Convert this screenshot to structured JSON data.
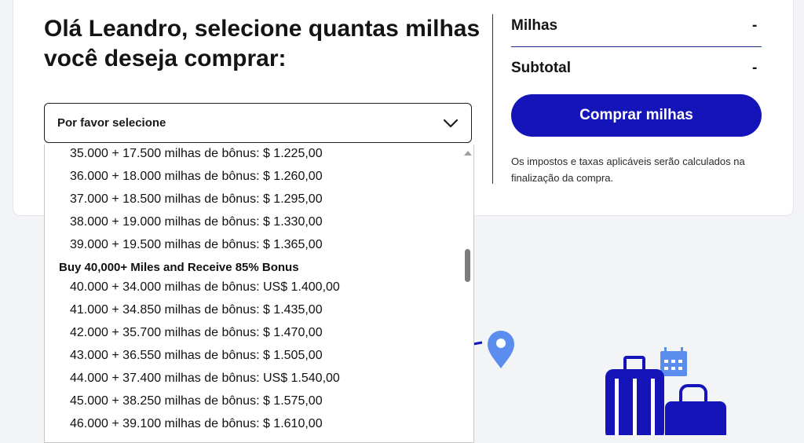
{
  "heading": "Olá Leandro, selecione quantas milhas você deseja comprar:",
  "select": {
    "value": "Por favor selecione"
  },
  "dropdown": {
    "rows": [
      {
        "kind": "option",
        "text": "35.000 + 17.500 milhas de bônus: $ 1.225,00"
      },
      {
        "kind": "option",
        "text": "36.000 + 18.000 milhas de bônus: $ 1.260,00"
      },
      {
        "kind": "option",
        "text": "37.000 + 18.500 milhas de bônus: $ 1.295,00"
      },
      {
        "kind": "option",
        "text": "38.000 + 19.000 milhas de bônus: $ 1.330,00"
      },
      {
        "kind": "option",
        "text": "39.000 + 19.500 milhas de bônus: $ 1.365,00"
      },
      {
        "kind": "group",
        "text": "Buy 40,000+ Miles and Receive 85% Bonus"
      },
      {
        "kind": "option",
        "text": "40.000 + 34.000 milhas de bônus: US$ 1.400,00"
      },
      {
        "kind": "option",
        "text": "41.000 + 34.850 milhas de bônus: $ 1.435,00"
      },
      {
        "kind": "option",
        "text": "42.000 + 35.700 milhas de bônus: $ 1.470,00"
      },
      {
        "kind": "option",
        "text": "43.000 + 36.550 milhas de bônus: $ 1.505,00"
      },
      {
        "kind": "option",
        "text": "44.000 + 37.400 milhas de bônus: US$ 1.540,00"
      },
      {
        "kind": "option",
        "text": "45.000 + 38.250 milhas de bônus: $ 1.575,00"
      },
      {
        "kind": "option",
        "text": "46.000 + 39.100 milhas de bônus: $ 1.610,00"
      }
    ]
  },
  "summary": {
    "miles_label": "Milhas",
    "miles_value": "-",
    "subtotal_label": "Subtotal",
    "subtotal_value": "-",
    "buy_button": "Comprar milhas",
    "note": "Os impostos e taxas aplicáveis serão calculados na finalização da compra."
  },
  "icons": {
    "chevron": "chevron-down-icon",
    "pin": "map-pin-icon",
    "calendar": "calendar-icon",
    "luggage": "luggage-icon"
  },
  "colors": {
    "brand_blue": "#1414b9",
    "accent_light_blue": "#5b8def",
    "divider": "#1f2a8a"
  }
}
